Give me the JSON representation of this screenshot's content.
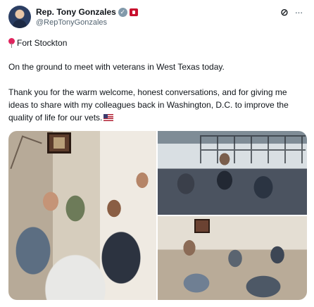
{
  "post": {
    "author_name": "Rep. Tony Gonzales",
    "handle": "@RepTonyGonzales",
    "location": "Fort Stockton",
    "paragraph1": "On the ground to meet with veterans in West Texas today.",
    "paragraph2": "Thank you for the warm welcome, honest conversations, and for giving me ideas to share with my colleagues back in Washington, D.C. to improve the quality of life for our vets.",
    "icons": {
      "verified": "verified-badge-icon",
      "affiliation": "affiliation-badge-icon",
      "grok": "grok-icon",
      "more": "more-icon",
      "pin": "round-pushpin-icon",
      "flag": "us-flag-icon"
    },
    "colors": {
      "text": "#0f1419",
      "secondary": "#536471",
      "verified": "#829aab",
      "affiliation": "#c8102e"
    }
  },
  "media": {
    "photo_count": 3
  }
}
